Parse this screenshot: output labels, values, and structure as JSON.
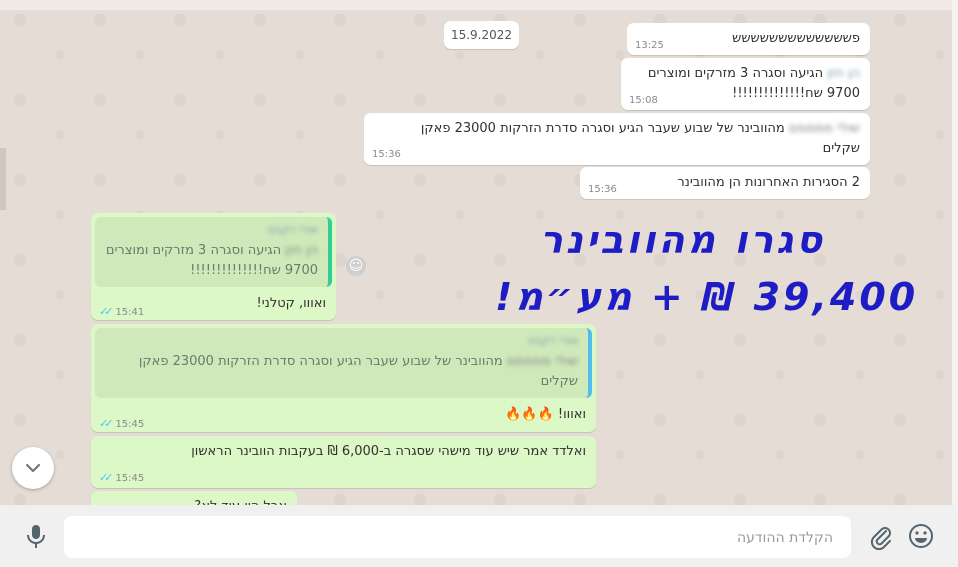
{
  "chat": {
    "date_label": "15.9.2022",
    "messages": [
      {
        "id": "m1",
        "text": "פששששששששששששש",
        "time": "13:25"
      },
      {
        "id": "m2",
        "sender": "הן חזן",
        "text": "הגיעה וסגרה 3 מזרקים ומוצרים\n9700 שח!!!!!!!!!!!!!!",
        "time": "15:08"
      },
      {
        "id": "m3",
        "sender": "שולי ממממם",
        "text": "מהוובינר של שבוע שעבר הגיע וסגרה סדרת הזרקות 23000 פאקן\nשקלים",
        "time": "15:36"
      },
      {
        "id": "m4",
        "text": "2 הסגירות האחרונות הן מהוובינר",
        "time": "15:36"
      },
      {
        "id": "m5",
        "quote_author": "אורי רקבט",
        "quote_sender": "הן חזן",
        "quote_text": "הגיעה וסגרה 3 מזרקים ומוצרים\n9700 שח!!!!!!!!!!!!!!",
        "text": "ואווו, קטלני!",
        "time": "15:41"
      },
      {
        "id": "m6",
        "quote_author": "אורי רקבט",
        "quote_sender": "שולי ממממם",
        "quote_text": "מהוובינר של שבוע שעבר הגיע וסגרה סדרת הזרקות 23000 פאקן\nשקלים",
        "text": "ואווו! 🔥🔥🔥",
        "time": "15:45"
      },
      {
        "id": "m7",
        "text": "ואלדד אמר שיש עוד מישהי שסגרה ב-6,000 ₪ בעקבות הוובינר הראשון",
        "time": "15:45"
      },
      {
        "id": "m8",
        "text": "אבל היו עוד לא?",
        "time": ""
      }
    ],
    "reaction_icon": "smiley-icon"
  },
  "overlay": {
    "line1": "סגרו מהוובינר",
    "line2": "39,400 ₪ + מע״מ!",
    "color": "#1e1cc4"
  },
  "composer": {
    "placeholder": "הקלדת ההודעה",
    "icons": [
      "emoji-icon",
      "attach-icon",
      "microphone-icon"
    ]
  },
  "colors": {
    "incoming": "#ffffff",
    "outgoing": "#dcf8c6",
    "ticks": "#4fc3f7"
  }
}
